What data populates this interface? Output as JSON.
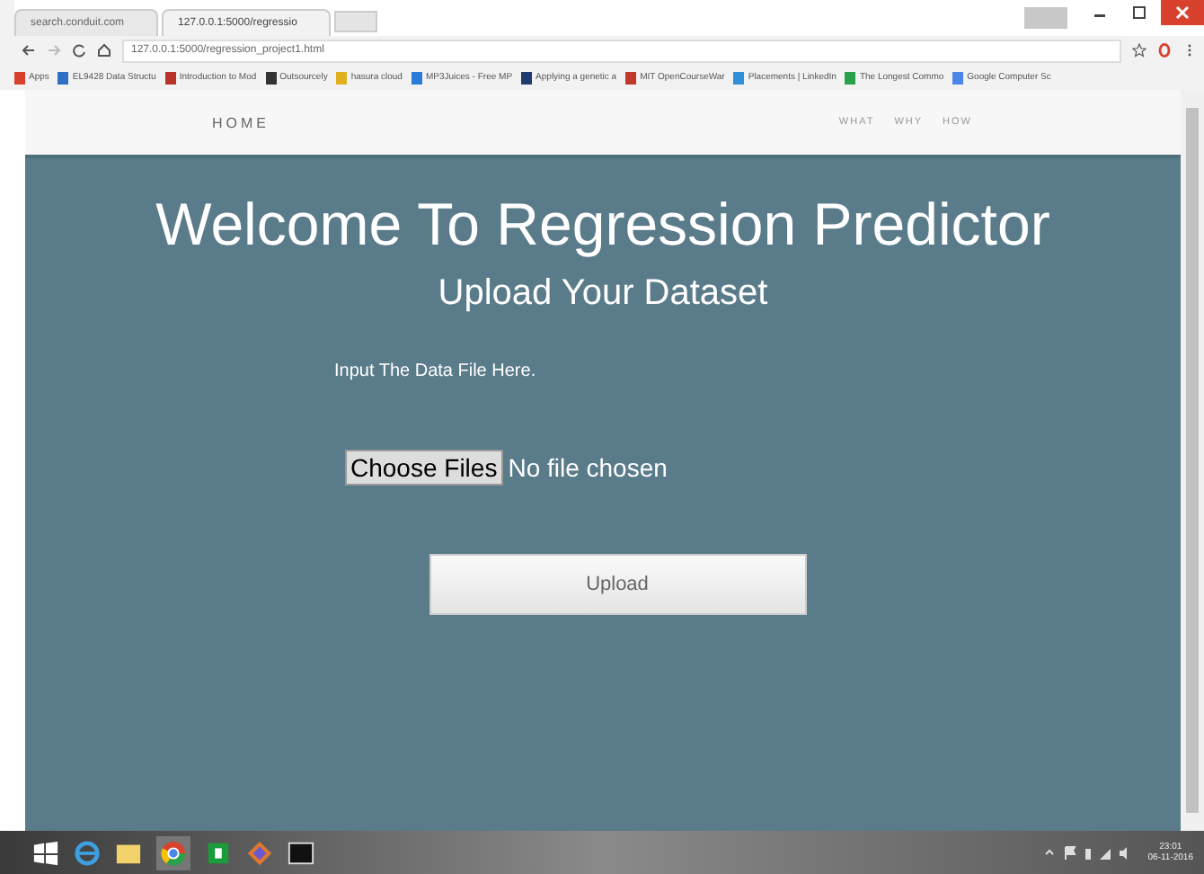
{
  "browser": {
    "tabs": [
      {
        "label": "search.conduit.com",
        "selected": false
      },
      {
        "label": "127.0.0.1:5000/regressio",
        "selected": true
      }
    ],
    "url": "127.0.0.1:5000/regression_project1.html",
    "bookmarks": [
      {
        "label": "Apps",
        "color": "#d9412f"
      },
      {
        "label": "EL9428 Data Structu",
        "color": "#2f6fc4"
      },
      {
        "label": "Introduction to Mod",
        "color": "#b8322a"
      },
      {
        "label": "Outsourcely",
        "color": "#333333"
      },
      {
        "label": "hasura cloud",
        "color": "#e0b020"
      },
      {
        "label": "MP3Juices - Free MP",
        "color": "#2a7bd6"
      },
      {
        "label": "Applying a genetic a",
        "color": "#1d3b6e"
      },
      {
        "label": "MIT OpenCourseWar",
        "color": "#c0392b"
      },
      {
        "label": "Placements | LinkedIn",
        "color": "#2f8fd6"
      },
      {
        "label": "The Longest Commo",
        "color": "#2aa04a"
      },
      {
        "label": "Google Computer Sc",
        "color": "#4a86e8"
      }
    ]
  },
  "navbar": {
    "brand": "HOME",
    "links": [
      "WHAT",
      "WHY",
      "HOW"
    ]
  },
  "main": {
    "title": "Welcome To Regression Predictor",
    "subtitle": "Upload Your Dataset",
    "prompt": "Input The Data File Here.",
    "file_button": "Choose Files",
    "file_status": "No file chosen",
    "upload_button": "Upload"
  },
  "taskbar": {
    "time": "23:01",
    "date": "06-11-2016"
  }
}
